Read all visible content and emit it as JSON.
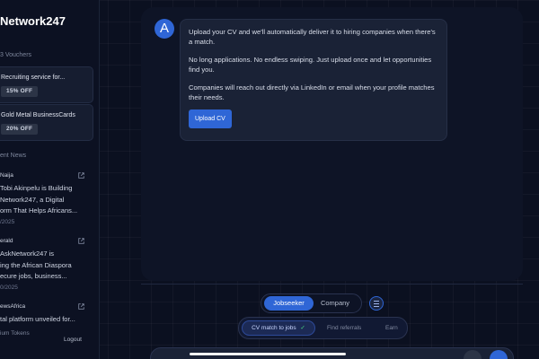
{
  "sidebar": {
    "brand": "Network247",
    "vouchers_label": "3 Vouchers",
    "vouchers": [
      {
        "title": "Recruiting service for...",
        "badge": "15% OFF"
      },
      {
        "title": "Gold Metal BusinessCards",
        "badge": "20% OFF"
      }
    ],
    "news_label": "ent News",
    "news": [
      {
        "source": "Naija",
        "text": "Tobi Akinpelu is Building\nNetwork247, a Digital\norm That Helps Africans...",
        "date": "/2025"
      },
      {
        "source": "erald",
        "text": "AskNetwork247 is\ning the African Diaspora\necure jobs, business...",
        "date": "0/2025"
      },
      {
        "source": "ewsAfrica",
        "text": "tal platform unveiled for...",
        "date": ""
      }
    ],
    "footer_left": "ium Tokens",
    "logout": "Logout"
  },
  "chat": {
    "avatar_letter": "A",
    "message_paragraphs": [
      "Upload your CV and we'll automatically deliver it to hiring companies when there's a match.",
      "No long applications. No endless swiping. Just upload once and let opportunities find you.",
      "Companies will reach out directly via LinkedIn or email when your profile matches their needs."
    ],
    "upload_button": "Upload CV"
  },
  "controls": {
    "toggle": {
      "active": "Jobseeker",
      "inactive": "Company"
    },
    "modes": {
      "active": "CV match to jobs",
      "items": [
        "Find referrals",
        "Earn"
      ]
    }
  },
  "colors": {
    "accent": "#2f66d6",
    "background": "#0b1020",
    "panel": "#0e1426"
  }
}
